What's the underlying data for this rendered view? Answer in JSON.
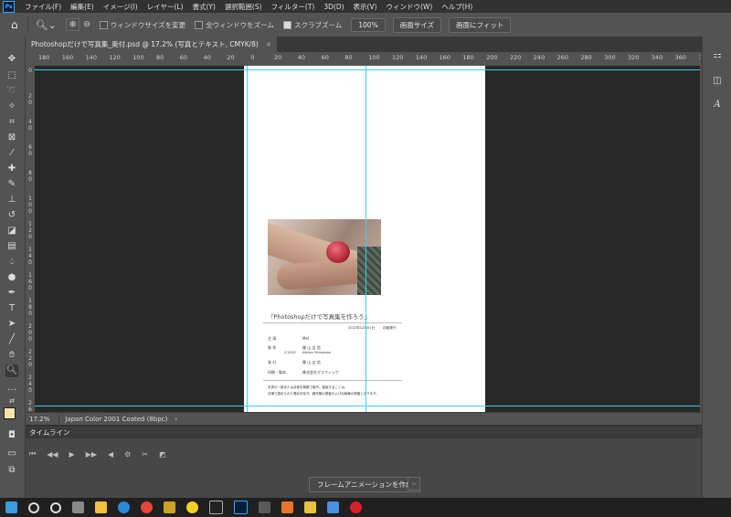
{
  "app": {
    "logo": "Ps"
  },
  "menu": [
    "ファイル(F)",
    "編集(E)",
    "イメージ(I)",
    "レイヤー(L)",
    "書式(Y)",
    "選択範囲(S)",
    "フィルター(T)",
    "3D(D)",
    "表示(V)",
    "ウィンドウ(W)",
    "ヘルプ(H)"
  ],
  "options": {
    "resize_window_label": "ウィンドウサイズを変更",
    "zoom_all_label": "全ウィンドウをズーム",
    "scrubby_zoom_label": "スクラブズーム",
    "zoom_value": "100%",
    "fit_screen_label": "画面サイズ",
    "fill_screen_label": "画面にフィット"
  },
  "document_tab": {
    "title": "Photoshopだけで写真集_奥付.psd @ 17.2% (写真とテキスト, CMYK/8)",
    "close": "×"
  },
  "rulers": {
    "horizontal": [
      "180",
      "160",
      "140",
      "120",
      "100",
      "80",
      "60",
      "40",
      "20",
      "0",
      "20",
      "40",
      "60",
      "80",
      "100",
      "120",
      "140",
      "160",
      "180",
      "200",
      "220",
      "240",
      "260",
      "280",
      "300",
      "320",
      "340",
      "360",
      "380"
    ],
    "vertical": [
      "0",
      "2 0",
      "4 0",
      "6 0",
      "8 0",
      "1 0 0",
      "1 2 0",
      "1 4 0",
      "1 6 0",
      "1 8 0",
      "2 0 0",
      "2 2 0",
      "2 4 0",
      "2 6 0"
    ]
  },
  "page": {
    "book_title": "『Photoshopだけで写真集を作ろう』",
    "date": "2022年12月01日",
    "edition": "初版発行",
    "credits": [
      {
        "role": "主 演",
        "name": "Mei",
        "sub": ""
      },
      {
        "role": "制 作",
        "name": "篠 山 吉 信",
        "sub": "Kitchen Shinoyama",
        "prefix": "(C)2022"
      },
      {
        "role": "発 行",
        "name": "篠 山 吉 信",
        "sub": ""
      },
      {
        "role": "印刷・製本",
        "name": "株式会社グラフィック",
        "sub": ""
      }
    ],
    "notice_1": "本書の一部または全部を無断で複写、複製することは、",
    "notice_2": "法律で認められた場合を除き、著作権の侵害および出版権の侵害となります。"
  },
  "status": {
    "zoom": "17.2%",
    "profile": "Japan Color 2001 Coated (8bpc)",
    "arrow": "›"
  },
  "timeline": {
    "title": "タイムライン",
    "create_button": "フレームアニメーションを作成",
    "dropdown": "⌵"
  },
  "colors": {
    "foreground": "#f5e6a8",
    "background": "#ffffff",
    "guide": "#3fd0e8"
  }
}
